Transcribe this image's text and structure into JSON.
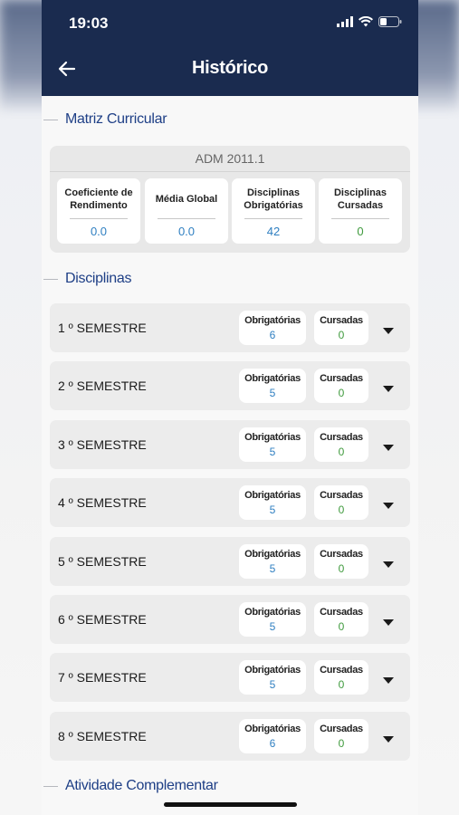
{
  "status_bar": {
    "time": "19:03"
  },
  "header": {
    "title": "Histórico"
  },
  "matriz": {
    "section_title": "Matriz Curricular",
    "code": "ADM 2011.1",
    "metrics": [
      {
        "label": "Coeficiente de Rendimento",
        "value": "0.0",
        "color": "#2f7fc1"
      },
      {
        "label": "Média Global",
        "value": "0.0",
        "color": "#2f7fc1"
      },
      {
        "label": "Disciplinas Obrigatórias",
        "value": "42",
        "color": "#2f7fc1"
      },
      {
        "label": "Disciplinas Cursadas",
        "value": "0",
        "color": "#3f9a3d"
      }
    ]
  },
  "disciplinas": {
    "section_title": "Disciplinas",
    "obrigatorias_label": "Obrigatórias",
    "cursadas_label": "Cursadas",
    "semesters": [
      {
        "name": "1 º SEMESTRE",
        "obrigatorias": "6",
        "cursadas": "0"
      },
      {
        "name": "2 º SEMESTRE",
        "obrigatorias": "5",
        "cursadas": "0"
      },
      {
        "name": "3 º SEMESTRE",
        "obrigatorias": "5",
        "cursadas": "0"
      },
      {
        "name": "4 º SEMESTRE",
        "obrigatorias": "5",
        "cursadas": "0"
      },
      {
        "name": "5 º SEMESTRE",
        "obrigatorias": "5",
        "cursadas": "0"
      },
      {
        "name": "6 º SEMESTRE",
        "obrigatorias": "5",
        "cursadas": "0"
      },
      {
        "name": "7 º SEMESTRE",
        "obrigatorias": "5",
        "cursadas": "0"
      },
      {
        "name": "8 º SEMESTRE",
        "obrigatorias": "6",
        "cursadas": "0"
      }
    ]
  },
  "atividade": {
    "section_title": "Atividade Complementar"
  },
  "colors": {
    "header_bg": "#1a2b4f",
    "section_title": "#1e3f86",
    "obrigatorias_value": "#2f7fc1",
    "cursadas_value": "#3f9a3d"
  }
}
